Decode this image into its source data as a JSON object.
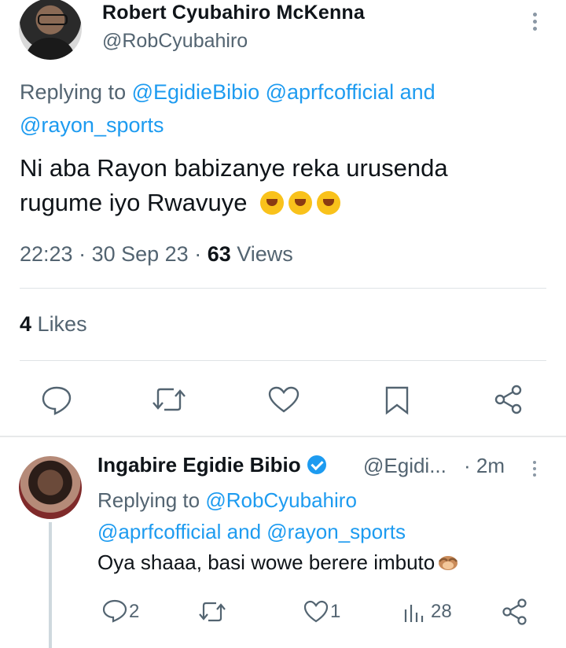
{
  "main_tweet": {
    "author_name": "Robert Cyubahiro McKenna",
    "author_handle": "@RobCyubahiro",
    "replying_prefix": "Replying to",
    "replying_mentions_1": "@EgidieBibio @aprfcofficial",
    "replying_and": "and",
    "replying_mentions_2": "@rayon_sports",
    "text_line1": "Ni aba Rayon babizanye reka urusenda",
    "text_line2": "rugume iyo Rwavuye",
    "emojis": [
      "rofl-emoji",
      "rofl-emoji",
      "rofl-emoji"
    ],
    "time": "22:23",
    "date": "30 Sep 23",
    "views_count": "63",
    "views_label": "Views",
    "likes_count": "4",
    "likes_label": "Likes",
    "actions": [
      "reply-icon",
      "retweet-icon",
      "like-icon",
      "bookmark-icon",
      "share-icon"
    ]
  },
  "reply_tweet": {
    "author_name": "Ingabire Egidie Bibio",
    "verified": true,
    "author_handle": "@Egidi...",
    "time": "· 2m",
    "replying_prefix": "Replying to",
    "replying_line1_mention": "@RobCyubahiro",
    "replying_line2_mention1": "@aprfcofficial",
    "replying_and": "and",
    "replying_line2_mention2": "@rayon_sports",
    "text": "Oya shaaa, basi wowe berere imbuto",
    "emoji": "see-no-evil-emoji",
    "reply_count": "2",
    "like_count": "1",
    "views_count": "28"
  },
  "colors": {
    "link": "#1d9bf0",
    "muted": "#536471",
    "text": "#0f1419"
  }
}
